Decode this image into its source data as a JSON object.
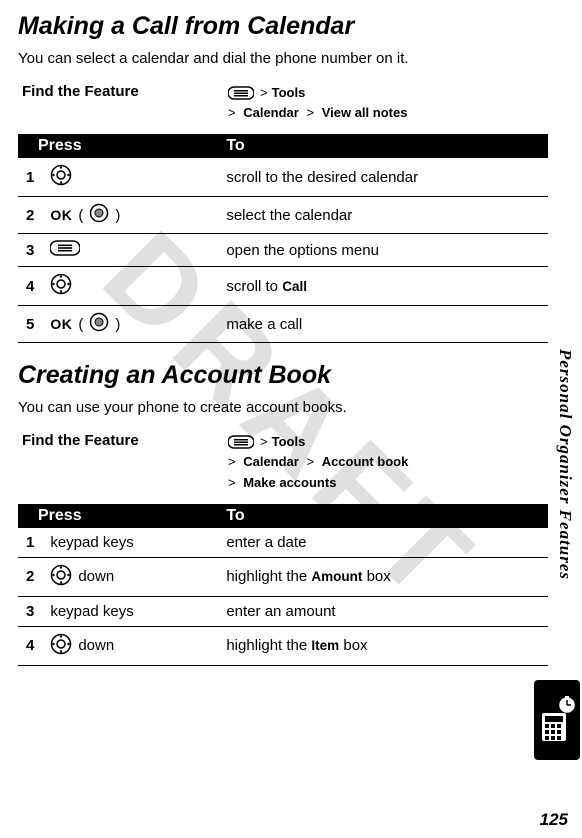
{
  "watermark": "DRAFT",
  "pageNumber": "125",
  "sideLabel": "Personal Organizer Features",
  "find_label": "Find the Feature",
  "table_headers": {
    "press": "Press",
    "to": "To"
  },
  "sections": {
    "call": {
      "title": "Making a Call from Calendar",
      "intro": "You can select a calendar and dial the phone number on it.",
      "path1_a": "Tools",
      "path2_a": "Calendar",
      "path2_b": "View all notes",
      "steps": [
        {
          "n": "1",
          "press_type": "nav",
          "to": "scroll to the desired calendar"
        },
        {
          "n": "2",
          "press_type": "ok",
          "ok": "OK",
          "to": "select the calendar"
        },
        {
          "n": "3",
          "press_type": "menu",
          "to": "open the options menu"
        },
        {
          "n": "4",
          "press_type": "nav",
          "to_pre": "scroll to ",
          "to_bold": "Call"
        },
        {
          "n": "5",
          "press_type": "ok",
          "ok": "OK",
          "to": "make a call"
        }
      ]
    },
    "account": {
      "title": "Creating an Account Book",
      "intro": "You can use your phone to create account books.",
      "path1_a": "Tools",
      "path2_a": "Calendar",
      "path2_b": "Account book",
      "path3_a": "Make accounts",
      "steps": [
        {
          "n": "1",
          "press_text": "keypad keys",
          "to": "enter a date"
        },
        {
          "n": "2",
          "press_type": "nav_down",
          "press_suffix": "down",
          "to_pre": "highlight the ",
          "to_bold": "Amount",
          "to_post": " box"
        },
        {
          "n": "3",
          "press_text": "keypad keys",
          "to": "enter an amount"
        },
        {
          "n": "4",
          "press_type": "nav_down",
          "press_suffix": "down",
          "to_pre": "highlight the ",
          "to_bold": "Item",
          "to_post": " box"
        }
      ]
    }
  }
}
